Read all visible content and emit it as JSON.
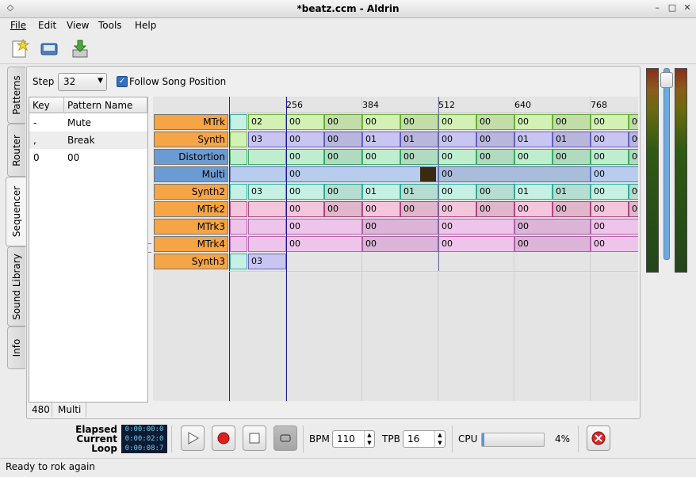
{
  "window": {
    "title": "*beatz.ccm - Aldrin"
  },
  "menu": [
    "File",
    "Edit",
    "View",
    "Tools",
    "Help"
  ],
  "tabs": [
    "Patterns",
    "Router",
    "Sequencer",
    "Sound Library",
    "Info"
  ],
  "sequencer_controls": {
    "step_label": "Step",
    "step_value": "32",
    "follow_label": "Follow Song Position",
    "follow_checked": true
  },
  "pattern_list": {
    "headers": [
      "Key",
      "Pattern Name"
    ],
    "rows": [
      {
        "key": "-",
        "name": "Mute"
      },
      {
        "key": ",",
        "name": "Break"
      },
      {
        "key": "0",
        "name": "00"
      }
    ]
  },
  "ruler": [
    "256",
    "384",
    "512",
    "640",
    "768"
  ],
  "tracks": [
    {
      "name": "MTrk",
      "color": "#f5a446"
    },
    {
      "name": "Synth",
      "color": "#f5a446"
    },
    {
      "name": "Distortion",
      "color": "#6b9bd2"
    },
    {
      "name": "Multi",
      "color": "#6b9bd2"
    },
    {
      "name": "Synth2",
      "color": "#f5a446"
    },
    {
      "name": "MTrk2",
      "color": "#f5a446"
    },
    {
      "name": "MTrk3",
      "color": "#f5a446"
    },
    {
      "name": "MTrk4",
      "color": "#f5a446"
    },
    {
      "name": "Synth3",
      "color": "#f5a446"
    }
  ],
  "grid_rows": [
    {
      "pre": "02",
      "cells": [
        "00",
        "00",
        "00",
        "00",
        "00",
        "00",
        "00",
        "00",
        "00",
        "00"
      ]
    },
    {
      "pre": "03",
      "cells": [
        "00",
        "00",
        "01",
        "01",
        "00",
        "00",
        "01",
        "01",
        "00",
        "00"
      ]
    },
    {
      "pre": "",
      "cells": [
        "00",
        "00",
        "00",
        "00",
        "00",
        "00",
        "00",
        "00",
        "00",
        "00"
      ]
    },
    {
      "pre": "",
      "cells": [
        "00",
        "00",
        "00"
      ]
    },
    {
      "pre": "03",
      "cells": [
        "00",
        "00",
        "01",
        "01",
        "00",
        "00",
        "01",
        "01",
        "00",
        "00"
      ]
    },
    {
      "pre": "",
      "cells": [
        "00",
        "00",
        "00",
        "00",
        "00",
        "00",
        "00",
        "00",
        "00",
        "00"
      ]
    },
    {
      "pre": "",
      "cells": [
        "00",
        "00",
        "00",
        "00",
        "00"
      ]
    },
    {
      "pre": "",
      "cells": [
        "00",
        "00",
        "00",
        "00",
        "00"
      ]
    },
    {
      "pre": "03",
      "cells": []
    }
  ],
  "position_bar": {
    "position": "480",
    "track": "Multi"
  },
  "transport": {
    "elapsed_label": "Elapsed",
    "elapsed": "0:00:00:0",
    "current_label": "Current",
    "current": "0:00:02:0",
    "loop_label": "Loop",
    "loop": "0:00:08:7",
    "bpm_label": "BPM",
    "bpm": "110",
    "tpb_label": "TPB",
    "tpb": "16",
    "cpu_label": "CPU",
    "cpu_percent": "4%",
    "cpu_fraction": 0.04
  },
  "status": "Ready to rok again",
  "colors": {
    "accent_line": "#1d1d8f"
  }
}
